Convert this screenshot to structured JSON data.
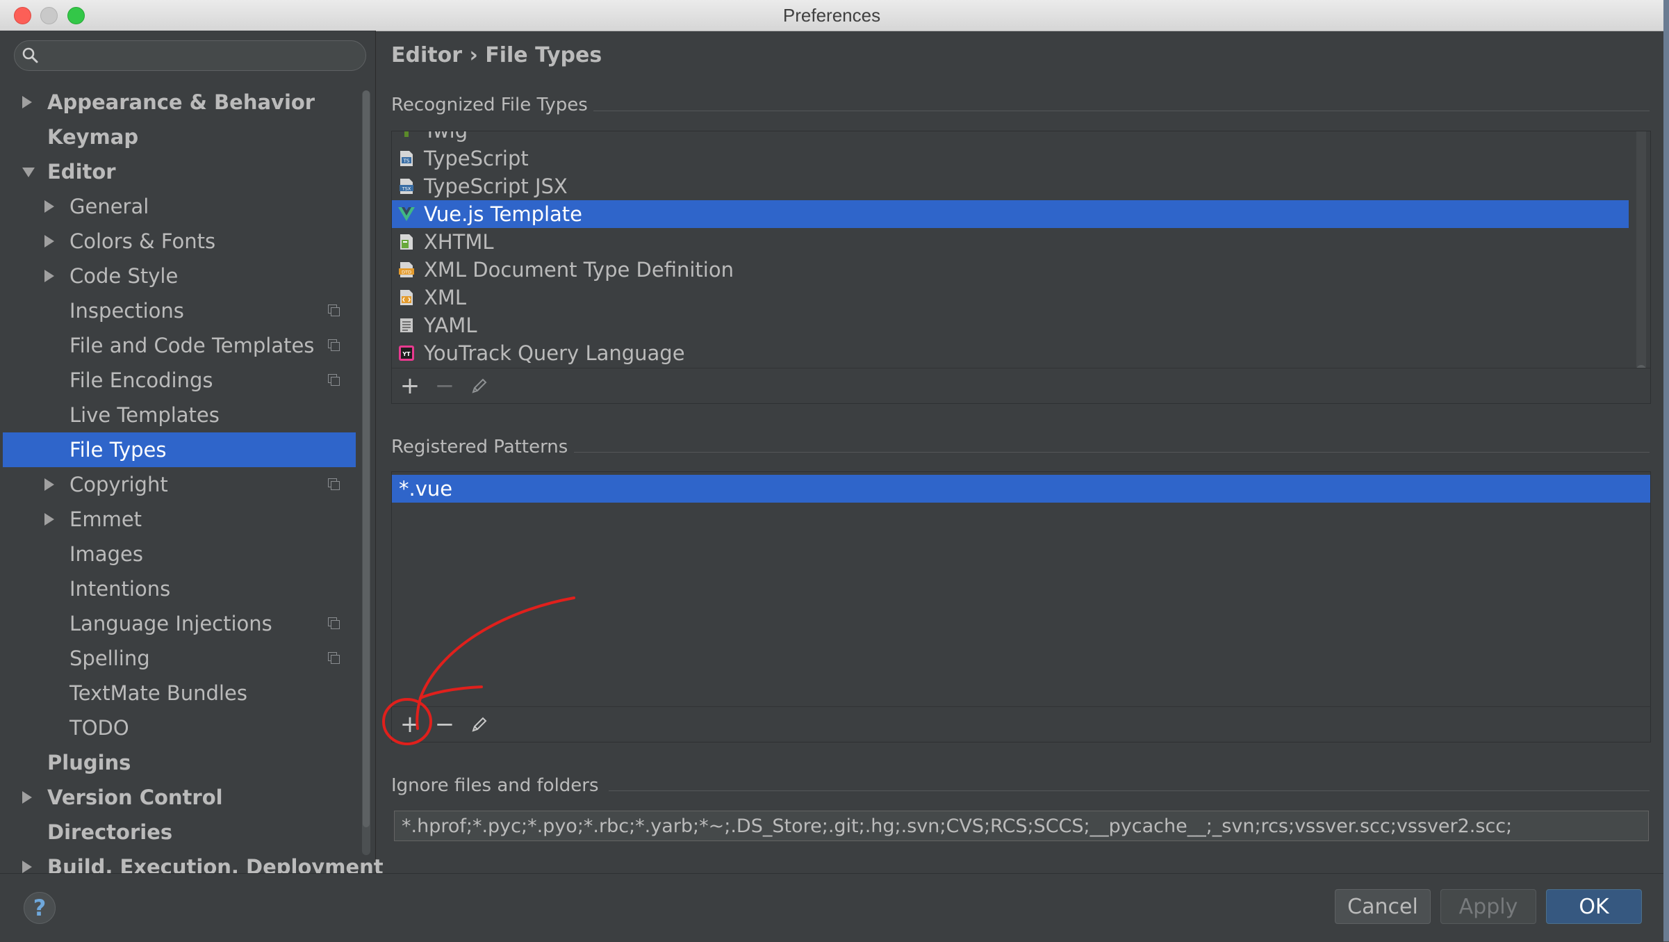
{
  "window": {
    "title": "Preferences"
  },
  "sidebar": {
    "search_placeholder": "",
    "items": [
      {
        "label": "Appearance & Behavior",
        "level": 0,
        "arrow": "right",
        "bold": true,
        "project": false,
        "selected": false
      },
      {
        "label": "Keymap",
        "level": 0,
        "arrow": "",
        "bold": true,
        "project": false,
        "selected": false
      },
      {
        "label": "Editor",
        "level": 0,
        "arrow": "down",
        "bold": true,
        "project": false,
        "selected": false
      },
      {
        "label": "General",
        "level": 1,
        "arrow": "right",
        "bold": false,
        "project": false,
        "selected": false
      },
      {
        "label": "Colors & Fonts",
        "level": 1,
        "arrow": "right",
        "bold": false,
        "project": false,
        "selected": false
      },
      {
        "label": "Code Style",
        "level": 1,
        "arrow": "right",
        "bold": false,
        "project": false,
        "selected": false
      },
      {
        "label": "Inspections",
        "level": 1,
        "arrow": "",
        "bold": false,
        "project": true,
        "selected": false
      },
      {
        "label": "File and Code Templates",
        "level": 1,
        "arrow": "",
        "bold": false,
        "project": true,
        "selected": false
      },
      {
        "label": "File Encodings",
        "level": 1,
        "arrow": "",
        "bold": false,
        "project": true,
        "selected": false
      },
      {
        "label": "Live Templates",
        "level": 1,
        "arrow": "",
        "bold": false,
        "project": false,
        "selected": false
      },
      {
        "label": "File Types",
        "level": 1,
        "arrow": "",
        "bold": false,
        "project": false,
        "selected": true
      },
      {
        "label": "Copyright",
        "level": 1,
        "arrow": "right",
        "bold": false,
        "project": true,
        "selected": false
      },
      {
        "label": "Emmet",
        "level": 1,
        "arrow": "right",
        "bold": false,
        "project": false,
        "selected": false
      },
      {
        "label": "Images",
        "level": 1,
        "arrow": "",
        "bold": false,
        "project": false,
        "selected": false
      },
      {
        "label": "Intentions",
        "level": 1,
        "arrow": "",
        "bold": false,
        "project": false,
        "selected": false
      },
      {
        "label": "Language Injections",
        "level": 1,
        "arrow": "",
        "bold": false,
        "project": true,
        "selected": false
      },
      {
        "label": "Spelling",
        "level": 1,
        "arrow": "",
        "bold": false,
        "project": true,
        "selected": false
      },
      {
        "label": "TextMate Bundles",
        "level": 1,
        "arrow": "",
        "bold": false,
        "project": false,
        "selected": false
      },
      {
        "label": "TODO",
        "level": 1,
        "arrow": "",
        "bold": false,
        "project": false,
        "selected": false
      },
      {
        "label": "Plugins",
        "level": 0,
        "arrow": "",
        "bold": true,
        "project": false,
        "selected": false
      },
      {
        "label": "Version Control",
        "level": 0,
        "arrow": "right",
        "bold": true,
        "project": false,
        "selected": false
      },
      {
        "label": "Directories",
        "level": 0,
        "arrow": "",
        "bold": true,
        "project": false,
        "selected": false
      },
      {
        "label": "Build, Execution, Deployment",
        "level": 0,
        "arrow": "right",
        "bold": true,
        "project": false,
        "selected": false
      }
    ]
  },
  "main": {
    "breadcrumb": "Editor › File Types",
    "recognized": {
      "label": "Recognized File Types",
      "items": [
        {
          "label": "Twig",
          "icon": "twig-icon",
          "selected": false
        },
        {
          "label": "TypeScript",
          "icon": "typescript-icon",
          "selected": false
        },
        {
          "label": "TypeScript JSX",
          "icon": "tsx-icon",
          "selected": false
        },
        {
          "label": "Vue.js Template",
          "icon": "vue-icon",
          "selected": true
        },
        {
          "label": "XHTML",
          "icon": "xhtml-icon",
          "selected": false
        },
        {
          "label": "XML Document Type Definition",
          "icon": "dtd-icon",
          "selected": false
        },
        {
          "label": "XML",
          "icon": "xml-icon",
          "selected": false
        },
        {
          "label": "YAML",
          "icon": "yaml-icon",
          "selected": false
        },
        {
          "label": "YouTrack Query Language",
          "icon": "youtrack-icon",
          "selected": false
        }
      ]
    },
    "patterns": {
      "label": "Registered Patterns",
      "items": [
        {
          "label": "*.vue",
          "selected": true
        }
      ]
    },
    "ignore": {
      "label": "Ignore files and folders",
      "value": "*.hprof;*.pyc;*.pyo;*.rbc;*.yarb;*~;.DS_Store;.git;.hg;.svn;CVS;RCS;SCCS;__pycache__;_svn;rcs;vssver.scc;vssver2.scc;"
    },
    "toolbar": {
      "add": "+",
      "remove": "−"
    }
  },
  "footer": {
    "help": "?",
    "cancel": "Cancel",
    "apply": "Apply",
    "ok": "OK"
  },
  "colors": {
    "selection": "#2f65ca",
    "background": "#3c3f41",
    "annotation": "#e0201c",
    "ok_button": "#365880"
  }
}
